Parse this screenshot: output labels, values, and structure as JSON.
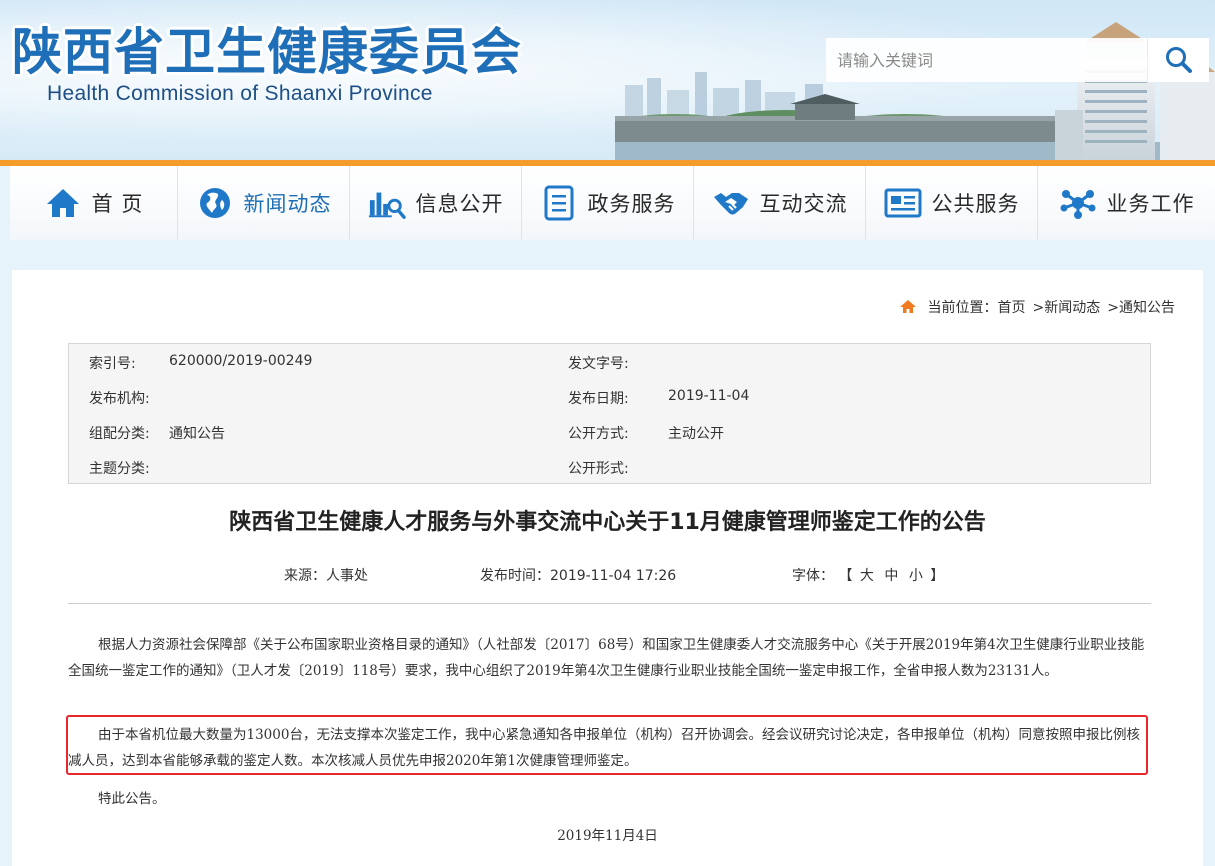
{
  "header": {
    "title_cn": "陕西省卫生健康委员会",
    "title_en": "Health Commission of Shaanxi Province",
    "search_placeholder": "请输入关键词"
  },
  "nav": {
    "items": [
      {
        "label": "首 页",
        "icon": "home-icon"
      },
      {
        "label": "新闻动态",
        "icon": "globe-icon"
      },
      {
        "label": "信息公开",
        "icon": "chart-search-icon"
      },
      {
        "label": "政务服务",
        "icon": "document-list-icon"
      },
      {
        "label": "互动交流",
        "icon": "handshake-icon"
      },
      {
        "label": "公共服务",
        "icon": "news-card-icon"
      },
      {
        "label": "业务工作",
        "icon": "network-icon"
      }
    ],
    "active_index": 1
  },
  "breadcrumb": {
    "prefix": "当前位置：",
    "items": [
      "首页",
      ">新闻动态",
      ">通知公告"
    ]
  },
  "meta": {
    "rows": [
      {
        "l_label": "索引号:",
        "l_value": "620000/2019-00249",
        "r_label": "发文字号:",
        "r_value": ""
      },
      {
        "l_label": "发布机构:",
        "l_value": "",
        "r_label": "发布日期:",
        "r_value": "2019-11-04"
      },
      {
        "l_label": "组配分类:",
        "l_value": "通知公告",
        "r_label": "公开方式:",
        "r_value": "主动公开"
      },
      {
        "l_label": "主题分类:",
        "l_value": "",
        "r_label": "公开形式:",
        "r_value": ""
      }
    ]
  },
  "article": {
    "title": "陕西省卫生健康人才服务与外事交流中心关于11月健康管理师鉴定工作的公告",
    "source": "来源：人事处",
    "publish_time": "发布时间：2019-11-04 17:26",
    "font_label": "字体：",
    "font_open": "【",
    "font_large": "大",
    "font_medium": "中",
    "font_small": "小",
    "font_close": "】",
    "paragraphs": [
      "根据人力资源社会保障部《关于公布国家职业资格目录的通知》（人社部发〔2017〕68号）和国家卫生健康委人才交流服务中心《关于开展2019年第4次卫生健康行业职业技能全国统一鉴定工作的通知》（卫人才发〔2019〕118号）要求，我中心组织了2019年第4次卫生健康行业职业技能全国统一鉴定申报工作，全省申报人数为23131人。",
      "由于本省机位最大数量为13000台，无法支撑本次鉴定工作，我中心紧急通知各申报单位（机构）召开协调会。经会议研究讨论决定，各申报单位（机构）同意按照申报比例核减人员，达到本省能够承载的鉴定人数。本次核减人员优先申报2020年第1次健康管理师鉴定。",
      "特此公告。"
    ],
    "date": "2019年11月4日"
  },
  "colors": {
    "brand_blue": "#1f6fb8",
    "nav_accent": "#f59b2a",
    "highlight_red": "#e8262b"
  }
}
